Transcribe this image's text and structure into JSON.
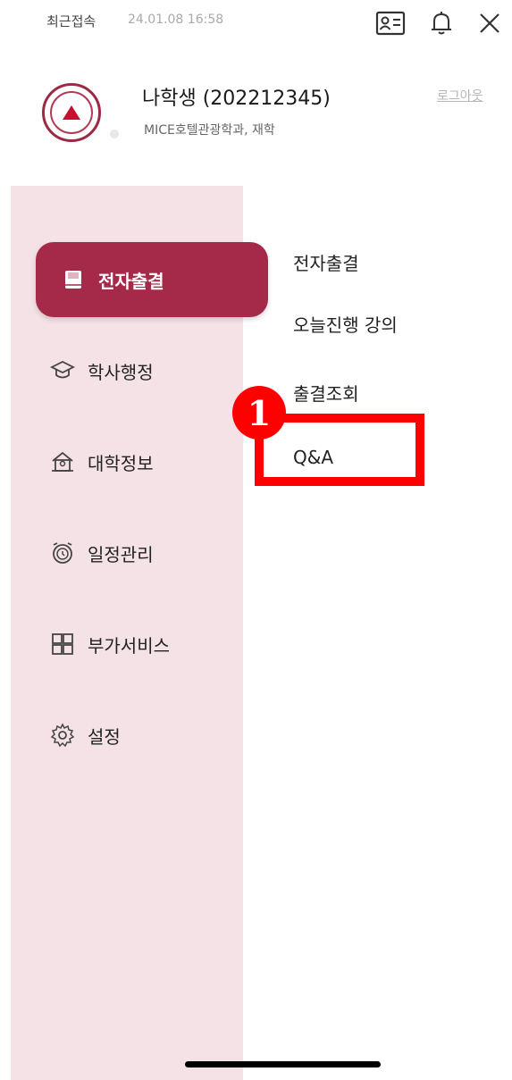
{
  "topbar": {
    "last_login_label": "최근접속",
    "last_login_time": "24.01.08 16:58",
    "icons": [
      "id-card-icon",
      "bell-icon",
      "close-icon"
    ]
  },
  "profile": {
    "name": "나학생 (202212345)",
    "dept": "MICE호텔관광학과, 재학",
    "logout_label": "로그아웃"
  },
  "menu": {
    "items": [
      {
        "label": "전자출결",
        "icon": "attendance-book-icon",
        "active": true
      },
      {
        "label": "학사행정",
        "icon": "graduation-cap-icon",
        "active": false
      },
      {
        "label": "대학정보",
        "icon": "university-building-icon",
        "active": false
      },
      {
        "label": "일정관리",
        "icon": "alarm-clock-icon",
        "active": false
      },
      {
        "label": "부가서비스",
        "icon": "grid-apps-icon",
        "active": false
      },
      {
        "label": "설정",
        "icon": "gear-icon",
        "active": false
      }
    ]
  },
  "submenu": {
    "items": [
      {
        "label": "전자출결"
      },
      {
        "label": "오늘진행 강의"
      },
      {
        "label": "출결조회"
      },
      {
        "label": "Q&A"
      }
    ]
  },
  "annotation": {
    "number": "1"
  },
  "colors": {
    "accent": "#a52a49",
    "panel_bg": "#f4e2e6",
    "highlight": "#ff0000"
  }
}
